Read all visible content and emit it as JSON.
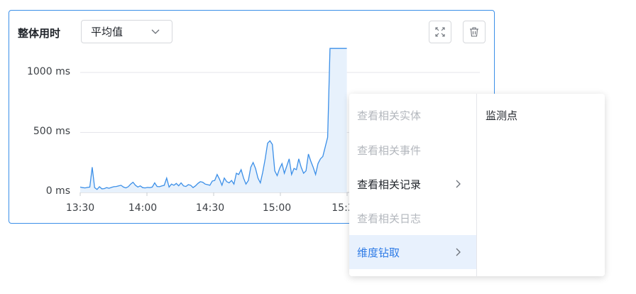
{
  "widget": {
    "title": "整体用时",
    "aggregation": {
      "selected": "平均值"
    },
    "buttons": {
      "fullscreen": "fullscreen-icon",
      "delete": "trash-icon"
    }
  },
  "chart_data": {
    "type": "area",
    "title": "",
    "xlabel": "",
    "ylabel": "",
    "y_ticks": [
      "1000 ms",
      "500 ms",
      "0 ms"
    ],
    "x_ticks": [
      "13:30",
      "14:00",
      "14:30",
      "15:00",
      "15:3"
    ],
    "y_unit": "ms",
    "ylim": [
      0,
      1000
    ],
    "series": [
      {
        "color": "#3b8fe8",
        "x_minutes_from_1330": [
          0,
          1,
          2,
          3,
          4,
          5,
          6,
          7,
          8,
          9,
          10,
          11,
          12,
          13,
          14,
          15,
          16,
          17,
          18,
          19,
          20,
          21,
          22,
          23,
          24,
          25,
          26,
          27,
          28,
          29,
          30,
          31,
          32,
          33,
          34,
          35,
          36,
          37,
          38,
          39,
          40,
          41,
          42,
          43,
          44,
          45,
          46,
          47,
          48,
          49,
          50,
          51,
          52,
          53,
          54,
          55,
          56,
          57,
          58,
          59,
          60,
          61,
          62,
          63,
          64,
          65,
          66,
          67,
          68,
          69,
          70,
          71,
          72,
          73,
          74,
          75,
          76,
          77,
          78,
          79,
          80,
          81,
          82,
          83,
          84,
          85,
          86,
          87,
          88,
          89,
          90,
          91,
          92,
          93,
          94,
          95,
          96,
          97,
          98,
          99,
          100,
          101,
          102,
          103,
          104,
          105,
          106,
          107,
          108,
          109,
          110,
          111
        ],
        "values": [
          45,
          40,
          38,
          42,
          45,
          210,
          40,
          25,
          48,
          30,
          32,
          40,
          35,
          42,
          48,
          50,
          55,
          60,
          45,
          38,
          48,
          70,
          85,
          60,
          45,
          55,
          40,
          38,
          42,
          40,
          45,
          80,
          50,
          48,
          55,
          60,
          120,
          45,
          70,
          60,
          75,
          55,
          80,
          55,
          50,
          65,
          60,
          40,
          55,
          75,
          90,
          85,
          70,
          65,
          60,
          95,
          100,
          150,
          110,
          60,
          120,
          90,
          80,
          100,
          70,
          160,
          150,
          190,
          120,
          70,
          100,
          210,
          250,
          200,
          120,
          80,
          170,
          280,
          410,
          430,
          400,
          180,
          140,
          200,
          240,
          160,
          220,
          280,
          150,
          200,
          190,
          280,
          210,
          160,
          180,
          320,
          260,
          210,
          150,
          240,
          280,
          300,
          380,
          460,
          1200,
          1200,
          1200,
          1200,
          1200,
          1200,
          1200,
          1200
        ]
      }
    ],
    "grid": true
  },
  "context_menu": {
    "primary_items": [
      {
        "label": "查看相关实体",
        "state": "disabled",
        "has_submenu": false
      },
      {
        "label": "查看相关事件",
        "state": "disabled",
        "has_submenu": false
      },
      {
        "label": "查看相关记录",
        "state": "normal",
        "has_submenu": true
      },
      {
        "label": "查看相关日志",
        "state": "disabled",
        "has_submenu": false
      },
      {
        "label": "维度钻取",
        "state": "active",
        "has_submenu": true
      }
    ],
    "submenu_items": [
      "监测点"
    ]
  }
}
